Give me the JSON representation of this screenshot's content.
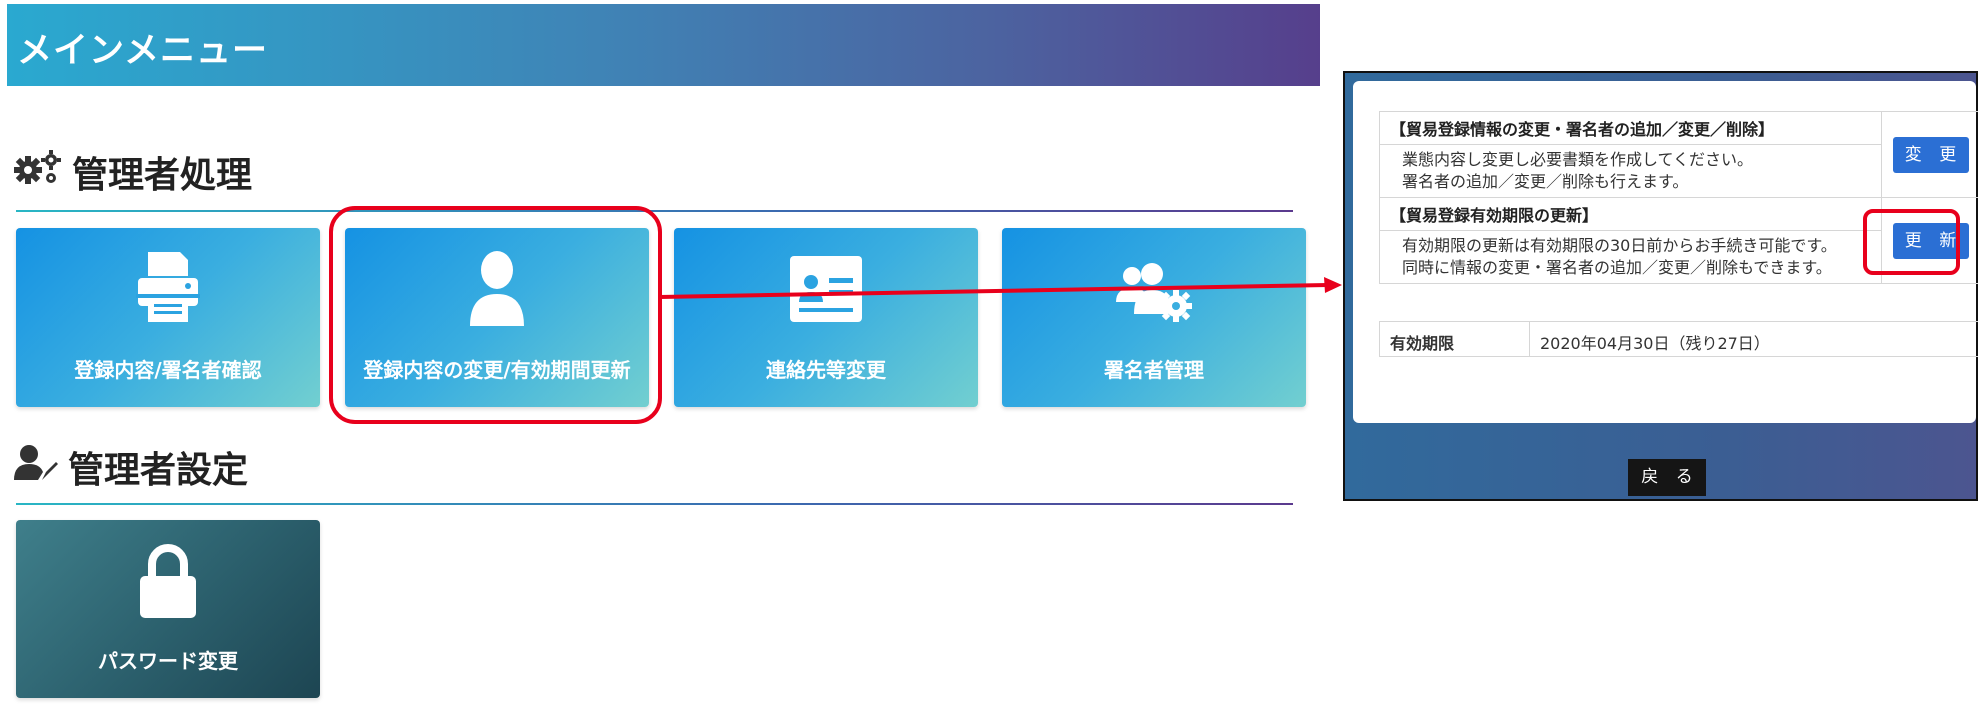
{
  "header": {
    "title": "メインメニュー"
  },
  "admin_processing": {
    "title": "管理者処理",
    "tiles": [
      {
        "label": "登録内容/署名者確認",
        "icon": "printer-icon"
      },
      {
        "label": "登録内容の変更/有効期間更新",
        "icon": "user-icon"
      },
      {
        "label": "連絡先等変更",
        "icon": "id-card-icon"
      },
      {
        "label": "署名者管理",
        "icon": "users-gear-icon"
      }
    ]
  },
  "admin_settings": {
    "title": "管理者設定",
    "tiles": [
      {
        "label": "パスワード変更",
        "icon": "lock-icon"
      }
    ]
  },
  "popup": {
    "section1": {
      "heading": "【貿易登録情報の変更・署名者の追加／変更／削除】",
      "line1": "業態内容し変更し必要書類を作成してください。",
      "line2": "署名者の追加／変更／削除も行えます。",
      "button": "変 更"
    },
    "section2": {
      "heading": "【貿易登録有効期限の更新】",
      "line1": "有効期限の更新は有効期限の30日前からお手続き可能です。",
      "line2": "同時に情報の変更・署名者の追加／変更／削除もできます。",
      "button": "更 新"
    },
    "validity": {
      "label": "有効期限",
      "value": "2020年04月30日（残り27日）"
    },
    "back_button": "戻 る"
  },
  "colors": {
    "highlight": "#e8001c",
    "button_blue": "#2b6fd4",
    "tile_gradient_start": "#1592e3"
  }
}
